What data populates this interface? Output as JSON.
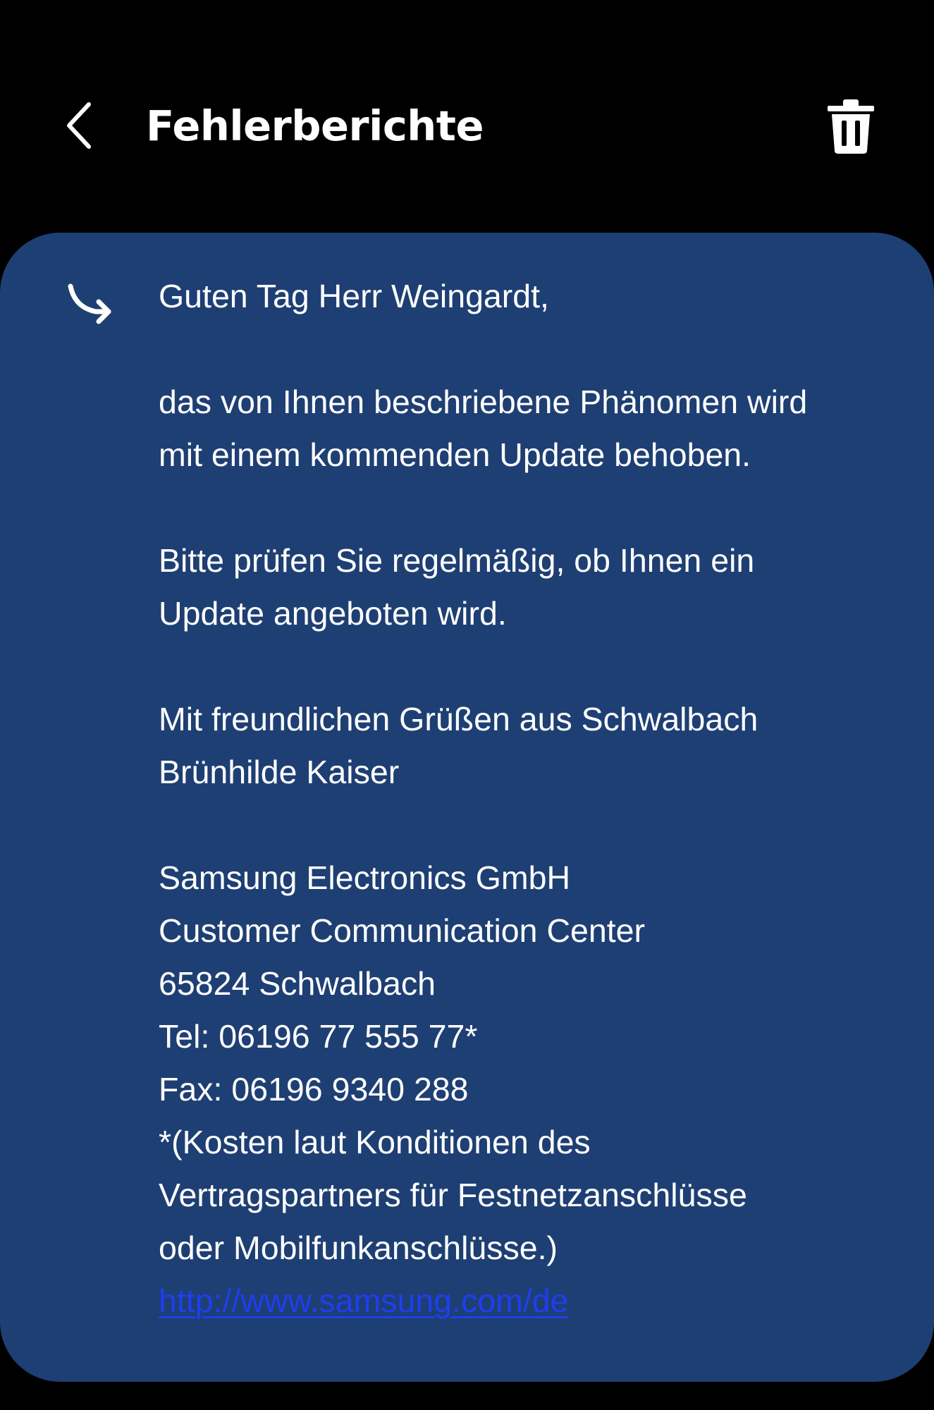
{
  "header": {
    "title": "Fehlerberichte",
    "back_icon": "chevron-left-icon",
    "delete_icon": "trash-icon"
  },
  "message": {
    "reply_icon": "reply-arrow-icon",
    "greeting": "Guten Tag Herr Weingardt,",
    "para1_line1": "das von Ihnen beschriebene Phänomen wird",
    "para1_line2": "mit einem kommenden Update behoben.",
    "para2_line1": "Bitte prüfen Sie regelmäßig, ob Ihnen ein",
    "para2_line2": "Update angeboten wird.",
    "closing": "Mit freundlichen Grüßen aus Schwalbach",
    "signature": "Brünhilde Kaiser",
    "company": "Samsung Electronics GmbH",
    "department": "Customer Communication Center",
    "address": "65824 Schwalbach",
    "tel": "Tel: 06196 77 555 77*",
    "fax": "Fax: 06196 9340 288",
    "note_line1": "*(Kosten laut Konditionen des",
    "note_line2": "Vertragspartners für Festnetzanschlüsse",
    "note_line3": "oder Mobilfunkanschlüsse.)",
    "link": "http://www.samsung.com/de "
  },
  "colors": {
    "background": "#000000",
    "card": "#1e3f73",
    "text": "#ffffff",
    "link": "#1f3ef0"
  }
}
